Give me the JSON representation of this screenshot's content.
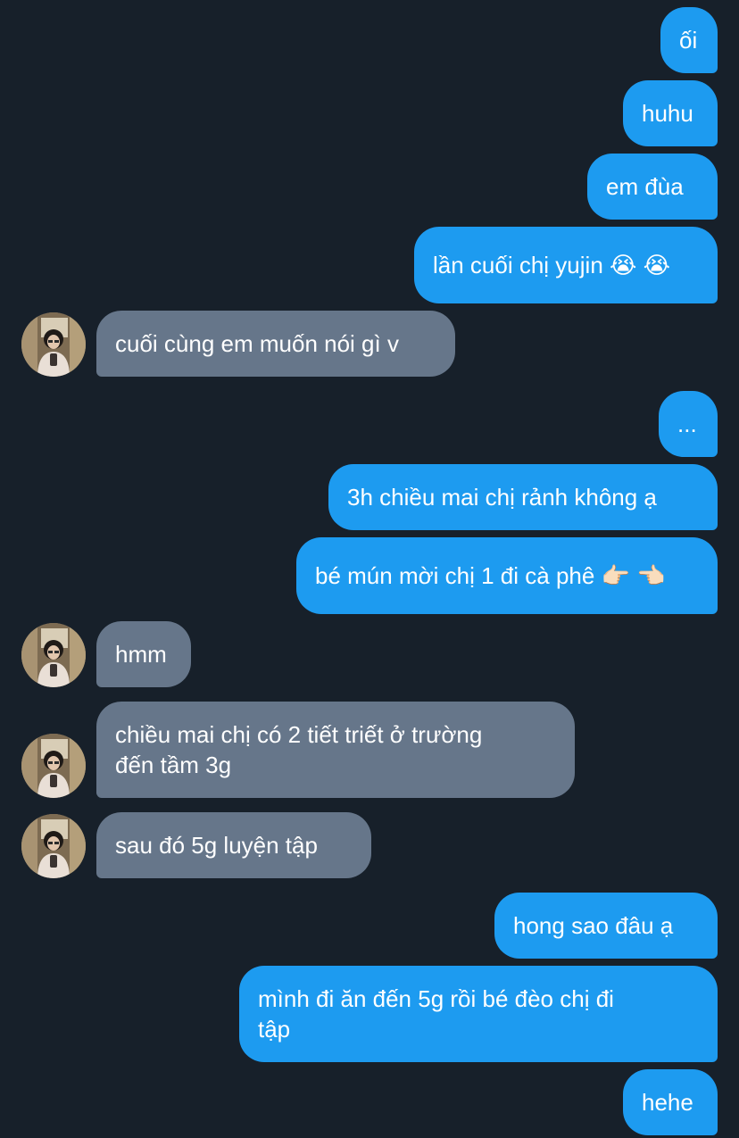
{
  "conversation": {
    "messages": [
      {
        "from": "me",
        "text": "ối"
      },
      {
        "from": "me",
        "text": "huhu"
      },
      {
        "from": "me",
        "text": "em đùa"
      },
      {
        "from": "me",
        "text": "lần cuối chị yujin 😭 😭"
      },
      {
        "from": "other",
        "text": "cuối cùng em muốn nói gì v"
      },
      {
        "from": "me",
        "text": "..."
      },
      {
        "from": "me",
        "text": "3h chiều mai chị rảnh không ạ"
      },
      {
        "from": "me",
        "text": "bé mún mời chị 1 đi cà phê 👉🏻 👈🏻"
      },
      {
        "from": "other",
        "text": "hmm"
      },
      {
        "from": "other",
        "text": "chiều mai chị có 2 tiết triết ở trường\nđến tầm 3g"
      },
      {
        "from": "other",
        "text": "sau đó 5g luyện tập"
      },
      {
        "from": "me",
        "text": "hong sao đâu ạ"
      },
      {
        "from": "me",
        "text": "mình đi ăn đến 5g rồi bé đèo chị đi\ntập"
      },
      {
        "from": "me",
        "text": "hehe"
      }
    ]
  },
  "colors": {
    "background": "#17202a",
    "outgoing_bubble": "#1d9bf0",
    "incoming_bubble": "#66768a",
    "text": "#ffffff"
  },
  "icons": {
    "contact_avatar": "avatar-photo"
  }
}
